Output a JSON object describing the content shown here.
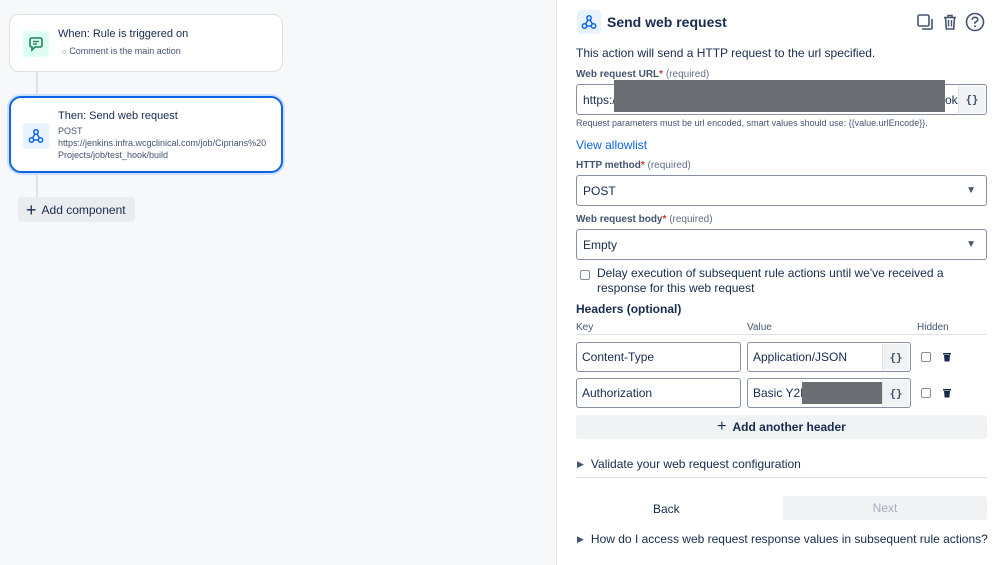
{
  "canvas": {
    "trigger": {
      "title": "When: Rule is triggered on",
      "subtitle": "Comment is the main action"
    },
    "action": {
      "title": "Then: Send web request",
      "method": "POST",
      "url_line1": "https://jenkins.infra.wcgclinical.com/job/Ciprians%20",
      "url_line2": "Projects/job/test_hook/build"
    },
    "add_component": "Add component"
  },
  "panel": {
    "title": "Send web request",
    "description": "This action will send a HTTP request to the url specified.",
    "url_field": {
      "label": "Web request URL",
      "required_text": "(required)",
      "value_start": "https:/",
      "value_end": "ok/",
      "smart_button": "{}"
    },
    "helper_text": "Request parameters must be url encoded, smart values should use: {{value.urlEncode}}.",
    "allowlist_link": "View allowlist",
    "method_field": {
      "label": "HTTP method",
      "required_text": "(required)",
      "value": "POST"
    },
    "body_field": {
      "label": "Web request body",
      "required_text": "(required)",
      "value": "Empty"
    },
    "delay_checkbox_label": "Delay execution of subsequent rule actions until we've received a response for this web request",
    "headers": {
      "title": "Headers (optional)",
      "col_key": "Key",
      "col_value": "Value",
      "col_hidden": "Hidden",
      "rows": [
        {
          "key": "Content-Type",
          "value": "Application/JSON"
        },
        {
          "key": "Authorization",
          "value": "Basic Y2R"
        }
      ],
      "add_label": "Add another header"
    },
    "validate_label": "Validate your web request configuration",
    "back_label": "Back",
    "next_label": "Next",
    "faq_label": "How do I access web request response values in subsequent rule actions?"
  },
  "colors": {
    "accent": "#0c66e4",
    "required": "#c9372c",
    "trigger_icon_bg": "#dcfff1",
    "action_icon_bg": "#e9f2ff"
  }
}
